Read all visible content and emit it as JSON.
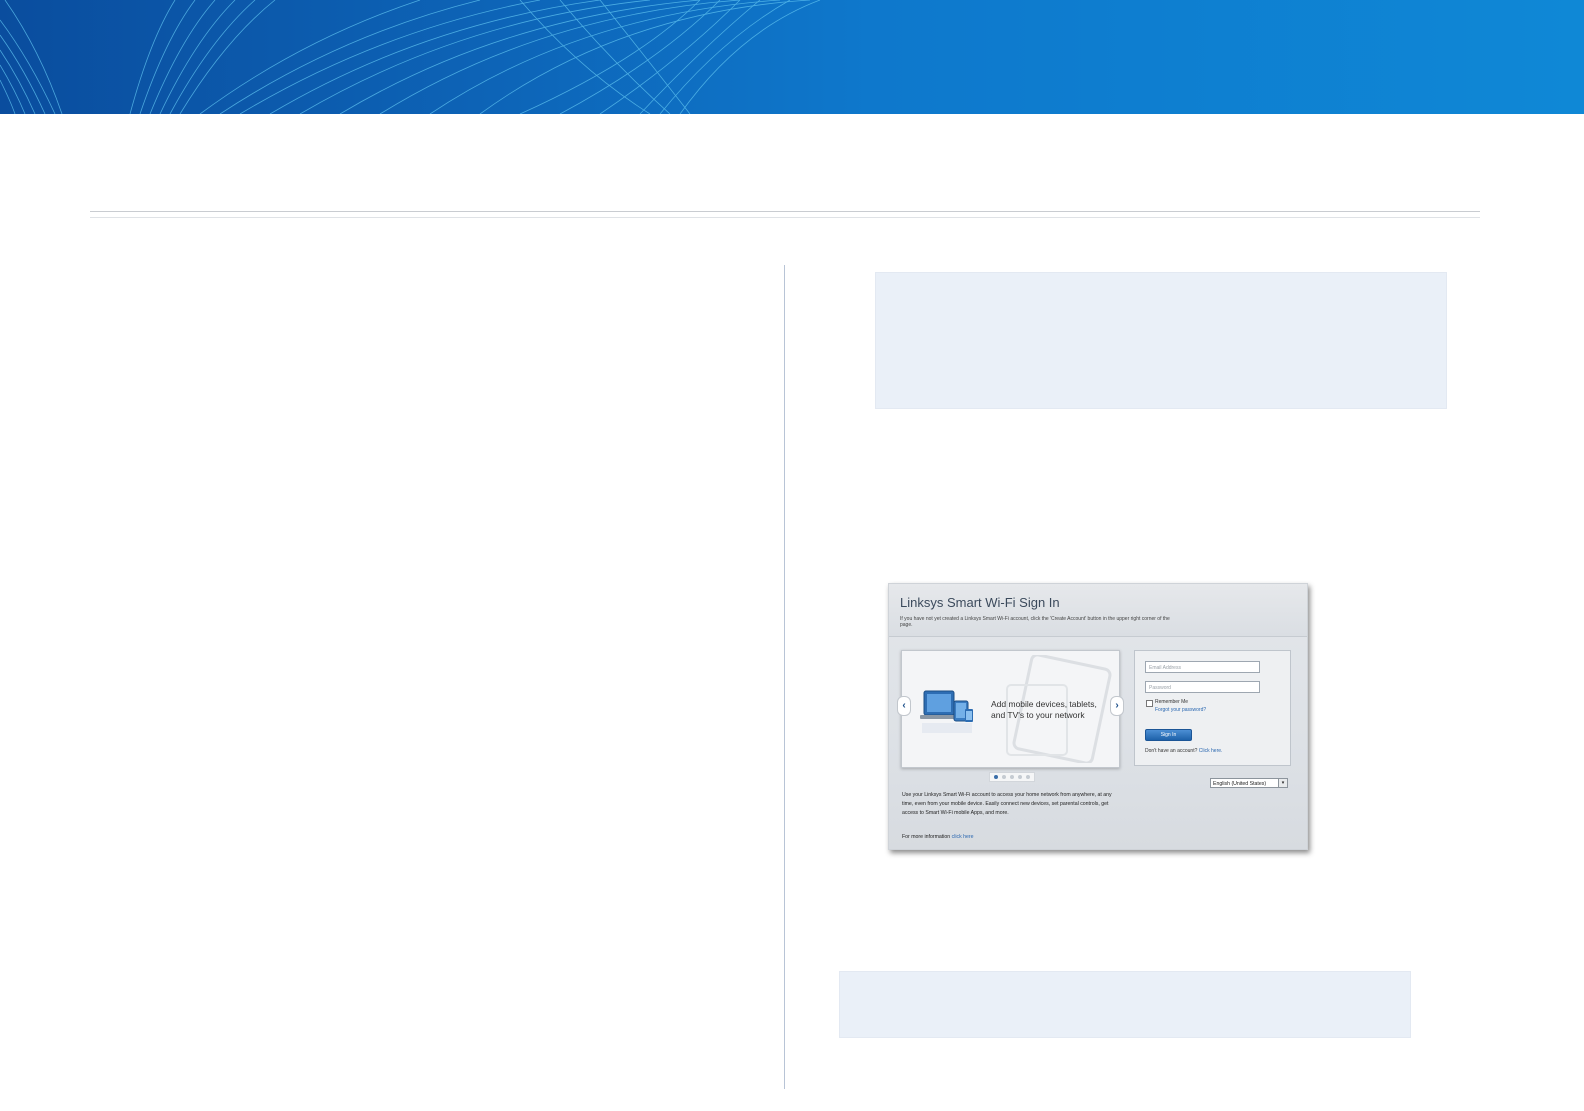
{
  "colors": {
    "banner": "#0e78cc",
    "note_box": "#eaf0f8",
    "link": "#2a67b0",
    "sign_in_button": "#1e62aa"
  },
  "signin_screenshot": {
    "title": "Linksys Smart Wi-Fi Sign In",
    "subtitle": "If you have not yet created a Linksys Smart Wi-Fi account, click the 'Create Account' button in the upper right corner of the page.",
    "carousel_text": "Add mobile devices, tablets, and TV's to your network",
    "description": "Use your Linksys Smart Wi-Fi account to access your home network from anywhere, at any time, even from your mobile device. Easily connect new devices, set parental controls, get access to Smart Wi-Fi mobile Apps, and more.",
    "more_info_label": "For more information",
    "more_info_link": "click here",
    "email_placeholder": "Email Address",
    "password_placeholder": "Password",
    "remember_me": "Remember Me",
    "forgot_password": "Forgot your password?",
    "sign_in_button": "Sign In",
    "no_account_label": "Don't have an account?",
    "no_account_link": "Click here.",
    "language": "English (United States)",
    "carousel_dot_count": 5,
    "carousel_active_dot": 1
  }
}
